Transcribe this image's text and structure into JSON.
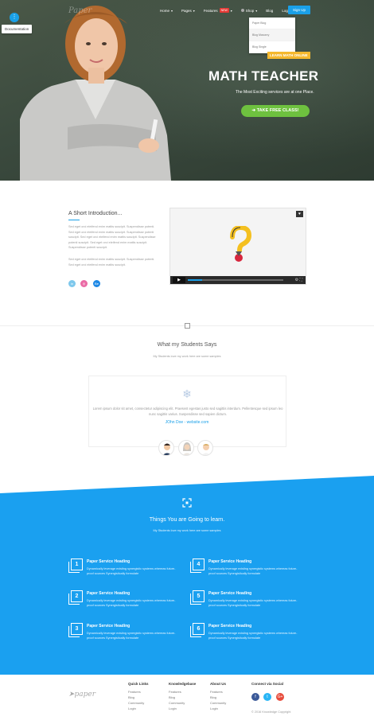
{
  "brand": {
    "logo_text": "Paper",
    "footer_logo_text": "paper"
  },
  "documentation": {
    "tooltip": "Documentation"
  },
  "nav": {
    "items": [
      {
        "label": "Home",
        "caret": "▾"
      },
      {
        "label": "Pages",
        "caret": "▾"
      },
      {
        "label": "Features",
        "badge": "NEW",
        "caret": "▾"
      },
      {
        "label": "Shop",
        "caret": "▾"
      },
      {
        "label": "Blog"
      },
      {
        "label": "Login"
      }
    ],
    "signup_label": "Sign Up",
    "dropdown": [
      "Paper Blog",
      "Blog Masonry",
      "Blog Single"
    ]
  },
  "hero": {
    "badge": "LEARN MATH ONLINE",
    "title": "MATH TEACHER",
    "subtitle": "The Most Exciting services are at one Place.",
    "cta_label": "TAKE FREE CLASS!",
    "cta_icon": "arrow-right-icon"
  },
  "intro": {
    "title": "A Short Introduction...",
    "paragraphs": [
      "Sed eget orci eleifend enim mattis suscipit. Suspendisse potenti. Sed eget orci eleifend enim mattis suscipit. Suspendisse potenti suscipit. Sed eget orci eleifend enim mattis suscipit. Suspendisse potenti suscipit. Sed eget orci eleifend enim mattis suscipit. Suspendisse potenti suscipit.",
      "Sed eget orci eleifend enim mattis suscipit. Suspendisse potenti. Sed eget orci eleifend enim mattis suscipit."
    ],
    "social": [
      {
        "icon": "linkedin-icon",
        "glyph": "in",
        "color": "#7ec8ec"
      },
      {
        "icon": "dribbble-icon",
        "glyph": "◎",
        "color": "#ea6aa5"
      },
      {
        "icon": "behance-icon",
        "glyph": "Be",
        "color": "#1e88e5"
      }
    ]
  },
  "testimonials": {
    "title": "What my Students Says",
    "subtitle": "My Students love my work here are some samples",
    "quote": "Lorem ipsum dolor sit amet, consectetur adipiscing elit. Praesent egestas justo sed sagittis interdum. Pellentesque sed ipsum leo nunc sagittis varius. Suspendisse sed sapien dictum.",
    "author": "JOhn Doe - website.com"
  },
  "features": {
    "title": "Things You are Going to learn.",
    "subtitle": "My Students love my work here are some samples",
    "items": [
      {
        "num": "1",
        "heading": "Paper Service Heading",
        "text": "Dynamically leverage existing synergistic systems whereas future-proof sources Synergistically formulate"
      },
      {
        "num": "4",
        "heading": "Paper Service Heading",
        "text": "Dynamically leverage existing synergistic systems whereas future-proof sources Synergistically formulate"
      },
      {
        "num": "2",
        "heading": "Paper Service Heading",
        "text": "Dynamically leverage existing synergistic systems whereas future-proof sources Synergistically formulate"
      },
      {
        "num": "5",
        "heading": "Paper Service Heading",
        "text": "Dynamically leverage existing synergistic systems whereas future-proof sources Synergistically formulate"
      },
      {
        "num": "3",
        "heading": "Paper Service Heading",
        "text": "Dynamically leverage existing synergistic systems whereas future-proof sources Synergistically formulate"
      },
      {
        "num": "6",
        "heading": "Paper Service Heading",
        "text": "Dynamically leverage existing synergistic systems whereas future-proof sources Synergistically formulate"
      }
    ]
  },
  "footer": {
    "columns": [
      {
        "heading": "Quick Links",
        "links": [
          "Features",
          "Blog",
          "Community",
          "Login"
        ]
      },
      {
        "heading": "Knowledgebase",
        "links": [
          "Features",
          "Blog",
          "Community",
          "Login"
        ]
      },
      {
        "heading": "About Us",
        "links": [
          "Features",
          "Blog",
          "Community",
          "Login"
        ]
      }
    ],
    "social_heading": "Connect via Social",
    "social": [
      {
        "icon": "facebook-icon",
        "glyph": "f",
        "color": "#3b5998"
      },
      {
        "icon": "twitter-icon",
        "glyph": "t",
        "color": "#29b6f6"
      },
      {
        "icon": "google-plus-icon",
        "glyph": "G+",
        "color": "#e74c3c"
      }
    ],
    "copyright": "© 2016 Knowledge Copyright"
  },
  "colors": {
    "accent": "#1aa0e8",
    "blue_section": "#1aa0f0",
    "cta_green": "#6ec13f",
    "badge_yellow": "#f5b82e"
  }
}
